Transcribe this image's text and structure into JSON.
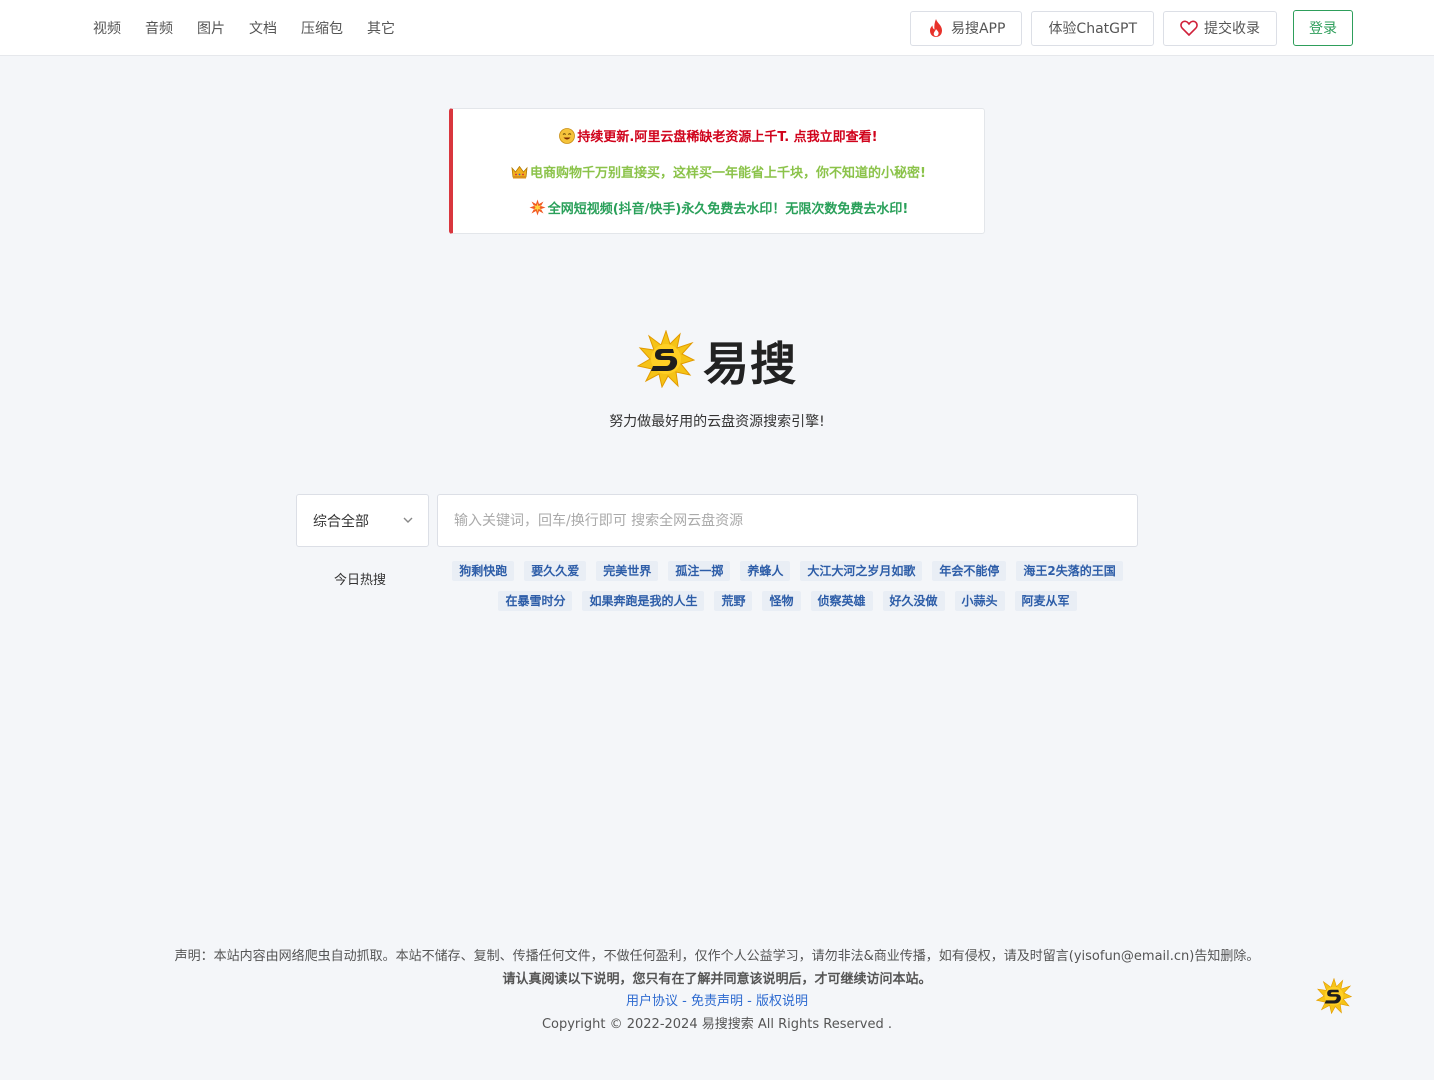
{
  "nav": {
    "links": [
      "视频",
      "音频",
      "图片",
      "文档",
      "压缩包",
      "其它"
    ],
    "app_label": "易搜APP",
    "chatgpt_label": "体验ChatGPT",
    "submit_label": "提交收录",
    "login_label": "登录"
  },
  "notice": {
    "line1": "持续更新.阿里云盘稀缺老资源上千T. 点我立即查看!",
    "line2": "电商购物千万别直接买，这样买一年能省上千块，你不知道的小秘密!",
    "line3": "全网短视频(抖音/快手)永久免费去水印！无限次数免费去水印!"
  },
  "logo": {
    "text": "易搜"
  },
  "slogan": "努力做最好用的云盘资源搜索引擎!",
  "search": {
    "category": "综合全部",
    "placeholder": "输入关键词，回车/换行即可 搜索全网云盘资源"
  },
  "hot": {
    "label": "今日热搜",
    "row1": [
      "狗剩快跑",
      "要久久爱",
      "完美世界",
      "孤注一掷",
      "养蜂人",
      "大江大河之岁月如歌",
      "年会不能停",
      "海王2失落的王国"
    ],
    "row2": [
      "在暴雪时分",
      "如果奔跑是我的人生",
      "荒野",
      "怪物",
      "侦察英雄",
      "好久没做",
      "小蒜头",
      "阿麦从军"
    ]
  },
  "footer": {
    "disclaimer": "声明：本站内容由网络爬虫自动抓取。本站不储存、复制、传播任何文件，不做任何盈利，仅作个人公益学习，请勿非法&商业传播，如有侵权，请及时留言(yisofun@email.cn)告知删除。",
    "notice": "请认真阅读以下说明，您只有在了解并同意该说明后，才可继续访问本站。",
    "agreement": "用户协议",
    "disclaimer_link": "免责声明",
    "copyright_link": "版权说明",
    "sep": " - ",
    "copyright": "Copyright © 2022-2024 易搜搜索 All Rights Reserved ."
  },
  "colors": {
    "accent_green": "#2e9e5b",
    "notice_red": "#d0021b",
    "notice_lightgreen": "#8bc34a",
    "notice_green": "#2aa05a",
    "tag_text": "#2d5da8",
    "link_blue": "#2d6ad0"
  }
}
